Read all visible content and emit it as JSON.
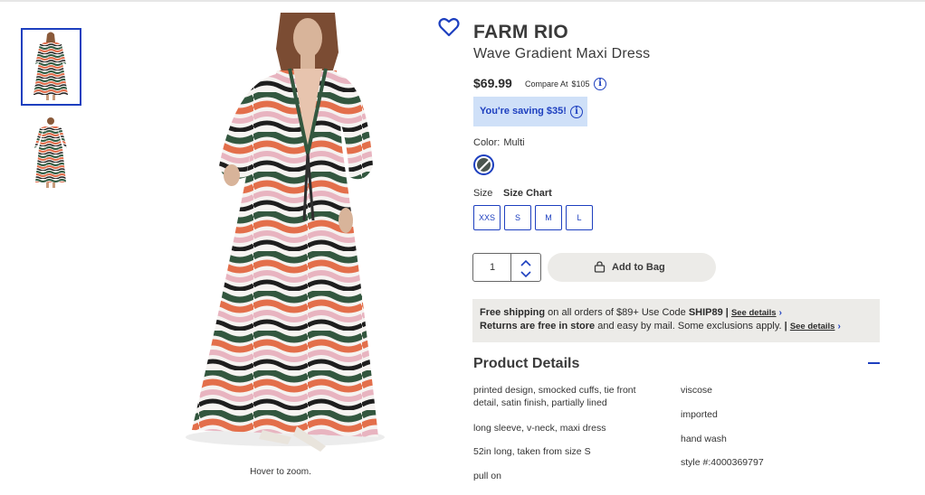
{
  "gallery": {
    "thumbnails": [
      "dress-front-thumb",
      "dress-back-thumb"
    ],
    "zoom_hint": "Hover to zoom."
  },
  "product": {
    "brand": "FARM RIO",
    "name": "Wave Gradient Maxi Dress",
    "price": "$69.99",
    "compare_label": "Compare At",
    "compare_price": "$105",
    "saving": "You're saving $35!",
    "color_label": "Color:",
    "color_value": "Multi",
    "size_label": "Size",
    "size_chart": "Size Chart",
    "sizes": [
      "XXS",
      "S",
      "M",
      "L"
    ],
    "quantity": "1",
    "add_to_bag": "Add to Bag",
    "wishlist_icon": "heart-icon"
  },
  "shipping": {
    "line1_bold": "Free shipping",
    "line1_text": " on all orders of $89+ Use Code ",
    "line1_code": "SHIP89",
    "line1_sep": " | ",
    "line1_link": "See details",
    "line2_bold": "Returns are free in store",
    "line2_text": " and easy by mail. Some exclusions apply. ",
    "line2_sep": "| ",
    "line2_link": "See details"
  },
  "details": {
    "title": "Product Details",
    "left": [
      "printed design, smocked cuffs, tie front detail, satin finish, partially lined",
      "long sleeve, v-neck, maxi dress",
      "52in long, taken from size S",
      "pull on"
    ],
    "right": [
      "viscose",
      "imported",
      "hand wash",
      "style #:4000369797"
    ]
  },
  "colors": {
    "accent": "#1d3fbf",
    "saving_bg": "#cfe0f8",
    "panel_bg": "#ecebe8"
  }
}
